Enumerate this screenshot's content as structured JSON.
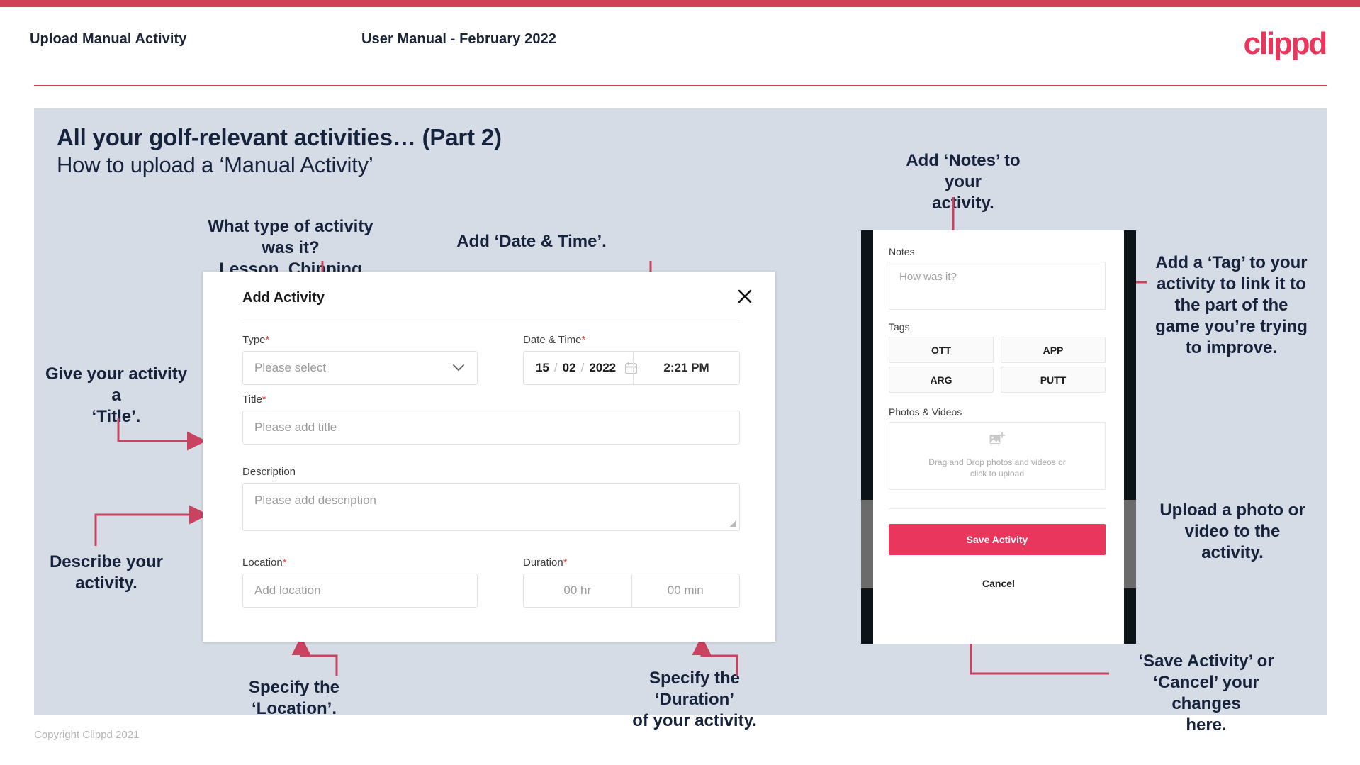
{
  "header": {
    "left_title": "Upload Manual Activity",
    "center_title": "User Manual - February 2022",
    "logo": "clippd"
  },
  "slide": {
    "title_bold": "All your golf-relevant activities… (Part 2)",
    "title_regular": "How to upload a ‘Manual Activity’"
  },
  "annotations": {
    "type": "What type of activity was it?\nLesson, Chipping etc.",
    "datetime": "Add ‘Date & Time’.",
    "title": "Give your activity a\n‘Title’.",
    "description": "Describe your\nactivity.",
    "location": "Specify the ‘Location’.",
    "duration": "Specify the ‘Duration’\nof your activity.",
    "notes": "Add ‘Notes’ to your\nactivity.",
    "tags": "Add a ‘Tag’ to your\nactivity to link it to\nthe part of the\ngame you’re trying\nto improve.",
    "photos": "Upload a photo or\nvideo to the activity.",
    "save_cancel": "‘Save Activity’ or\n‘Cancel’ your changes\nhere."
  },
  "dialog": {
    "title": "Add Activity",
    "close_icon": "close-icon",
    "type": {
      "label": "Type",
      "required": "*",
      "placeholder": "Please select",
      "chevron_icon": "chevron-down-icon"
    },
    "datetime": {
      "label": "Date & Time",
      "required": "*",
      "day": "15",
      "month": "02",
      "year": "2022",
      "sep": "/",
      "calendar_icon": "calendar-icon",
      "time": "2:21 PM"
    },
    "title_field": {
      "label": "Title",
      "required": "*",
      "placeholder": "Please add title"
    },
    "description": {
      "label": "Description",
      "placeholder": "Please add description"
    },
    "location": {
      "label": "Location",
      "required": "*",
      "placeholder": "Add location"
    },
    "duration": {
      "label": "Duration",
      "required": "*",
      "hours": "00 hr",
      "minutes": "00 min"
    }
  },
  "phone": {
    "notes": {
      "label": "Notes",
      "placeholder": "How was it?"
    },
    "tags": {
      "label": "Tags",
      "items": [
        "OTT",
        "APP",
        "ARG",
        "PUTT"
      ]
    },
    "photos": {
      "label": "Photos & Videos",
      "icon": "add-image-icon",
      "text": "Drag and Drop photos and videos or\nclick to upload"
    },
    "save_label": "Save Activity",
    "cancel_label": "Cancel"
  },
  "footer": {
    "copyright": "Copyright Clippd 2021"
  },
  "colors": {
    "brand_pink": "#e8365d",
    "header_rule": "#cf4158",
    "slide_bg": "#d6dce5",
    "text_dark": "#16233c",
    "arrow": "#c94260"
  }
}
